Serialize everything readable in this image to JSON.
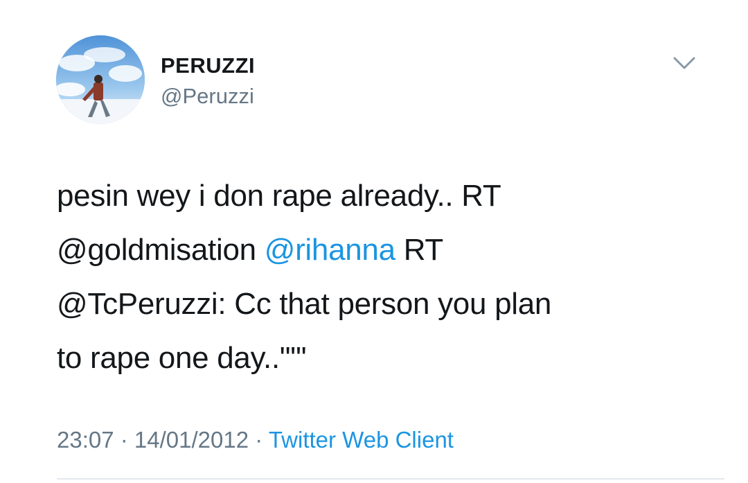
{
  "author": {
    "display_name": "PERUZZI",
    "handle": "@Peruzzi"
  },
  "tweet": {
    "line1": "pesin wey i don rape already.. RT",
    "line2_pre": "@goldmisation ",
    "line2_link": "@rihanna",
    "line2_post": " RT",
    "line3": "@TcPeruzzi: Cc that person you plan",
    "line4": "to rape one day..\"\"'"
  },
  "meta": {
    "time": "23:07",
    "sep1": " · ",
    "date": "14/01/2012",
    "sep2": " · ",
    "source": "Twitter Web Client"
  },
  "icons": {
    "menu": "chevron-down-icon"
  },
  "colors": {
    "link": "#1b95e0",
    "secondary_text": "#657786",
    "primary_text": "#14171a"
  }
}
